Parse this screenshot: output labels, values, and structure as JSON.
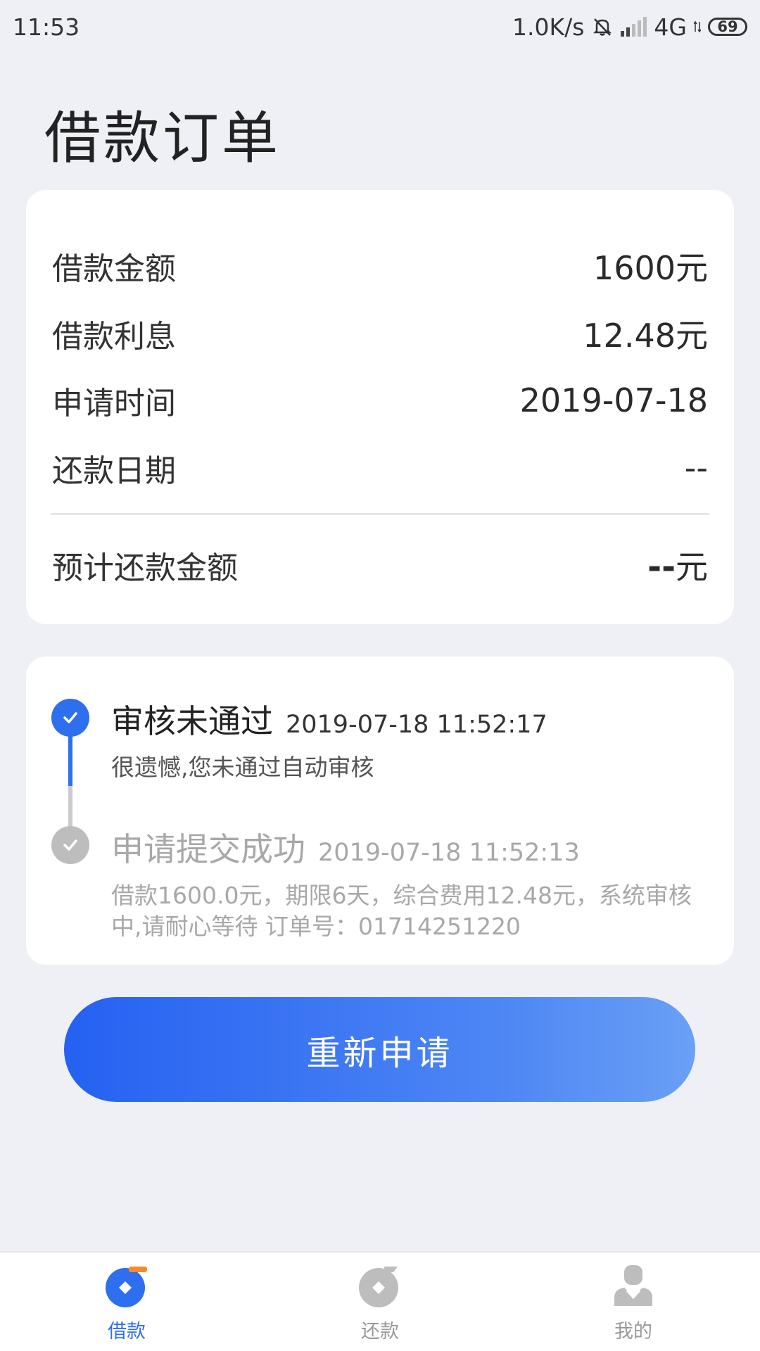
{
  "status_bar": {
    "time": "11:53",
    "network_speed": "1.0K/s",
    "network_type": "4G",
    "battery": "69"
  },
  "page": {
    "title": "借款订单"
  },
  "summary": {
    "rows": [
      {
        "label": "借款金额",
        "value": "1600元"
      },
      {
        "label": "借款利息",
        "value": "12.48元"
      },
      {
        "label": "申请时间",
        "value": "2019-07-18"
      },
      {
        "label": "还款日期",
        "value": "--"
      }
    ],
    "total_label": "预计还款金额",
    "total_value_dash": "--",
    "total_value_unit": "元"
  },
  "timeline": [
    {
      "status": "审核未通过",
      "time": "2019-07-18 11:52:17",
      "description": "很遗憾,您未通过自动审核",
      "state": "active"
    },
    {
      "status": "申请提交成功",
      "time": "2019-07-18 11:52:13",
      "description": "借款1600.0元，期限6天，综合费用12.48元，系统审核中,请耐心等待 订单号：01714251220",
      "state": "done"
    }
  ],
  "reapply_button": {
    "label": "重新申请"
  },
  "bottom_nav": {
    "items": [
      {
        "label": "借款",
        "icon": "loan-icon",
        "active": true
      },
      {
        "label": "还款",
        "icon": "repay-icon",
        "active": false
      },
      {
        "label": "我的",
        "icon": "profile-icon",
        "active": false
      }
    ]
  },
  "colors": {
    "accent": "#2e6ff0",
    "accent_orange": "#f58a2c",
    "background": "#eef0f5",
    "inactive": "#bdbdbd"
  }
}
